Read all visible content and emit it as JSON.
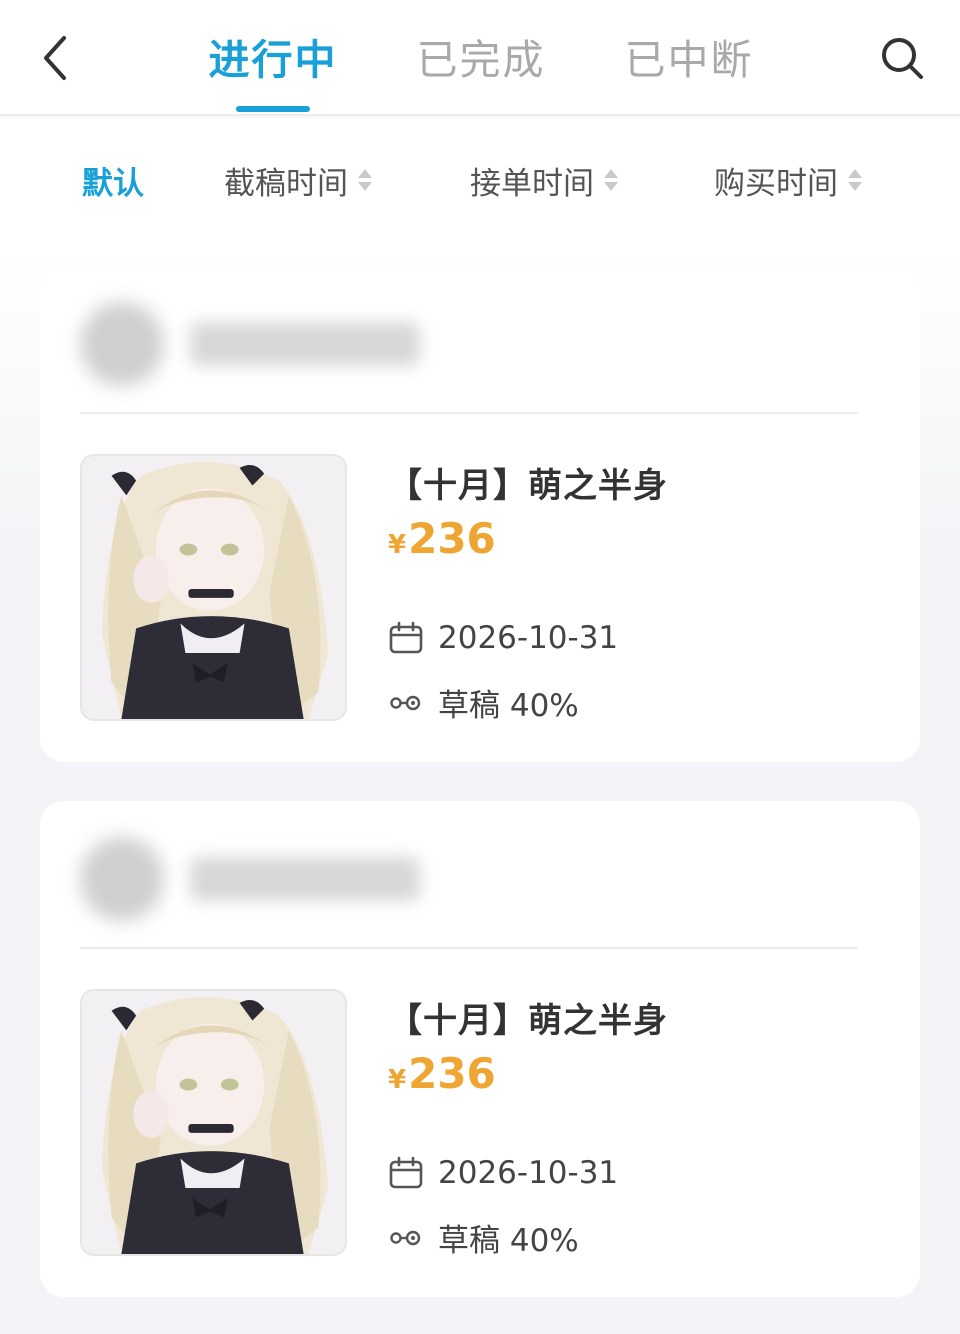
{
  "header": {
    "tabs": [
      {
        "label": "进行中",
        "active": true
      },
      {
        "label": "已完成",
        "active": false
      },
      {
        "label": "已中断",
        "active": false
      }
    ],
    "back_icon": "chevron-left-icon",
    "search_icon": "search-icon"
  },
  "sort": {
    "items": [
      {
        "label": "默认",
        "active": true
      },
      {
        "label": "截稿时间",
        "active": false
      },
      {
        "label": "接单时间",
        "active": false
      },
      {
        "label": "购买时间",
        "active": false
      }
    ]
  },
  "orders": [
    {
      "title": "【十月】萌之半身",
      "currency": "¥",
      "price": "236",
      "deadline": "2026-10-31",
      "progress": "草稿 40%"
    },
    {
      "title": "【十月】萌之半身",
      "currency": "¥",
      "price": "236",
      "deadline": "2026-10-31",
      "progress": "草稿 40%"
    }
  ],
  "colors": {
    "accent": "#1aa0d8",
    "price": "#efa531",
    "inactive_tab": "#a9a9a9"
  }
}
